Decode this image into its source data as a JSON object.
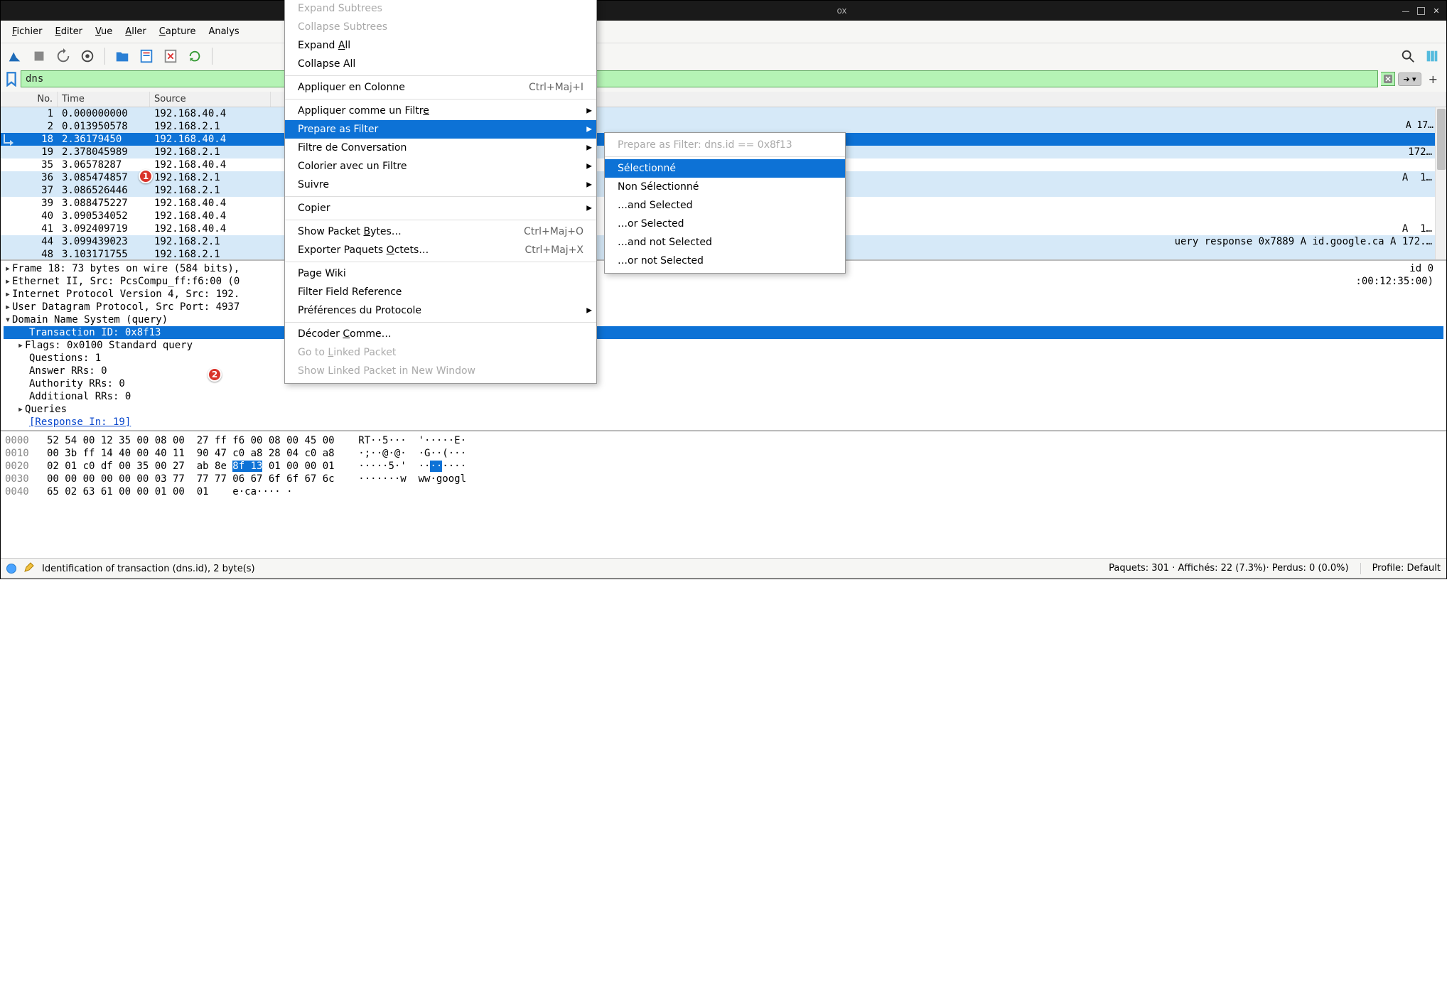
{
  "titlebar_hint": "ox",
  "menubar": [
    "Fichier",
    "Editer",
    "Vue",
    "Aller",
    "Capture",
    "Analys"
  ],
  "filter": {
    "value": "dns"
  },
  "columns": {
    "no": "No.",
    "time": "Time",
    "source": "Source"
  },
  "packets": [
    {
      "no": "1",
      "time": "0.000000000",
      "src": "192.168.40.4",
      "sel": false,
      "hl": true,
      "info": ""
    },
    {
      "no": "2",
      "time": "0.013950578",
      "src": "192.168.2.1",
      "sel": false,
      "hl": true,
      "info": ""
    },
    {
      "no": "18",
      "time": "2.36179450",
      "src": "192.168.40.4",
      "sel": true,
      "hl": false,
      "info": ""
    },
    {
      "no": "19",
      "time": "2.378045989",
      "src": "192.168.2.1",
      "sel": false,
      "hl": true,
      "info": "172…"
    },
    {
      "no": "35",
      "time": "3.06578287",
      "src": "192.168.40.4",
      "sel": false,
      "hl": false,
      "info": ""
    },
    {
      "no": "36",
      "time": "3.085474857",
      "src": "192.168.2.1",
      "sel": false,
      "hl": true,
      "info": "A  1…"
    },
    {
      "no": "37",
      "time": "3.086526446",
      "src": "192.168.2.1",
      "sel": false,
      "hl": true,
      "info": ""
    },
    {
      "no": "39",
      "time": "3.088475227",
      "src": "192.168.40.4",
      "sel": false,
      "hl": false,
      "info": ""
    },
    {
      "no": "40",
      "time": "3.090534052",
      "src": "192.168.40.4",
      "sel": false,
      "hl": false,
      "info": ""
    },
    {
      "no": "41",
      "time": "3.092409719",
      "src": "192.168.40.4",
      "sel": false,
      "hl": false,
      "info": "A  1…"
    },
    {
      "no": "44",
      "time": "3.099439023",
      "src": "192.168.2.1",
      "sel": false,
      "hl": true,
      "info": "uery response 0x7889 A id.google.ca A 172.…"
    },
    {
      "no": "48",
      "time": "3.103171755",
      "src": "192.168.2.1",
      "sel": false,
      "hl": true,
      "info": ""
    }
  ],
  "tree": {
    "frame": "Frame 18: 73 bytes on wire (584 bits),",
    "eth": "Ethernet II, Src: PcsCompu_ff:f6:00 (0",
    "ip": "Internet Protocol Version 4, Src: 192.",
    "udp": "User Datagram Protocol, Src Port: 4937",
    "dns": "Domain Name System (query)",
    "tid": "Transaction ID: 0x8f13",
    "flags": "Flags: 0x0100 Standard query",
    "q": "Questions: 1",
    "ans": "Answer RRs: 0",
    "auth": "Authority RRs: 0",
    "add": "Additional RRs: 0",
    "queries": "Queries",
    "resp": "[Response In: 19]",
    "right1": "id 0",
    "right2": ":00:12:35:00)"
  },
  "hex": [
    {
      "off": "0000",
      "b": "52 54 00 12 35 00 08 00  27 ff f6 00 08 00 45 00",
      "a": "RT··5···  '·····E·"
    },
    {
      "off": "0010",
      "b": "00 3b ff 14 40 00 40 11  90 47 c0 a8 28 04 c0 a8",
      "a": "·;··@·@·  ·G··(···"
    },
    {
      "off": "0020",
      "b": "02 01 c0 df 00 35 00 27  ab 8e ",
      "h": "8f 13",
      "b2": " 01 00 00 01",
      "a": "·····5·'  ··",
      "ah": "··",
      "a2": "····"
    },
    {
      "off": "0030",
      "b": "00 00 00 00 00 00 03 77  77 77 06 67 6f 6f 67 6c",
      "a": "·······w  ww·googl"
    },
    {
      "off": "0040",
      "b": "65 02 63 61 00 00 01 00  01",
      "a": "e·ca···· ·"
    }
  ],
  "status": {
    "field": "Identification of transaction (dns.id), 2 byte(s)",
    "pkts": "Paquets: 301 · Affichés: 22 (7.3%)· Perdus: 0 (0.0%)",
    "profile": "Profile: Default"
  },
  "menu1": {
    "expand_subtrees": "Expand Subtrees",
    "collapse_subtrees": "Collapse Subtrees",
    "expand_all": "Expand All",
    "collapse_all": "Collapse All",
    "apply_col": "Appliquer en Colonne",
    "apply_col_accel": "Ctrl+Maj+I",
    "apply_filter": "Appliquer comme un Filtre",
    "prepare": "Prepare as Filter",
    "conv": "Filtre de Conversation",
    "color": "Colorier avec un Filtre",
    "follow": "Suivre",
    "copy": "Copier",
    "show_bytes": "Show Packet Bytes…",
    "show_bytes_accel": "Ctrl+Maj+O",
    "export": "Exporter Paquets Octets…",
    "export_accel": "Ctrl+Maj+X",
    "wiki": "Page Wiki",
    "ffr": "Filter Field Reference",
    "prefs": "Préférences du Protocole",
    "decode": "Décoder Comme…",
    "goto": "Go to Linked Packet",
    "show_linked": "Show Linked Packet in New Window"
  },
  "menu2": {
    "header": "Prepare as Filter: dns.id == 0x8f13",
    "sel": "Sélectionné",
    "nsel": "Non Sélectionné",
    "and": "…and Selected",
    "or": "…or Selected",
    "andnot": "…and not Selected",
    "ornot": "…or not Selected"
  },
  "info_overflow": "A  17…"
}
